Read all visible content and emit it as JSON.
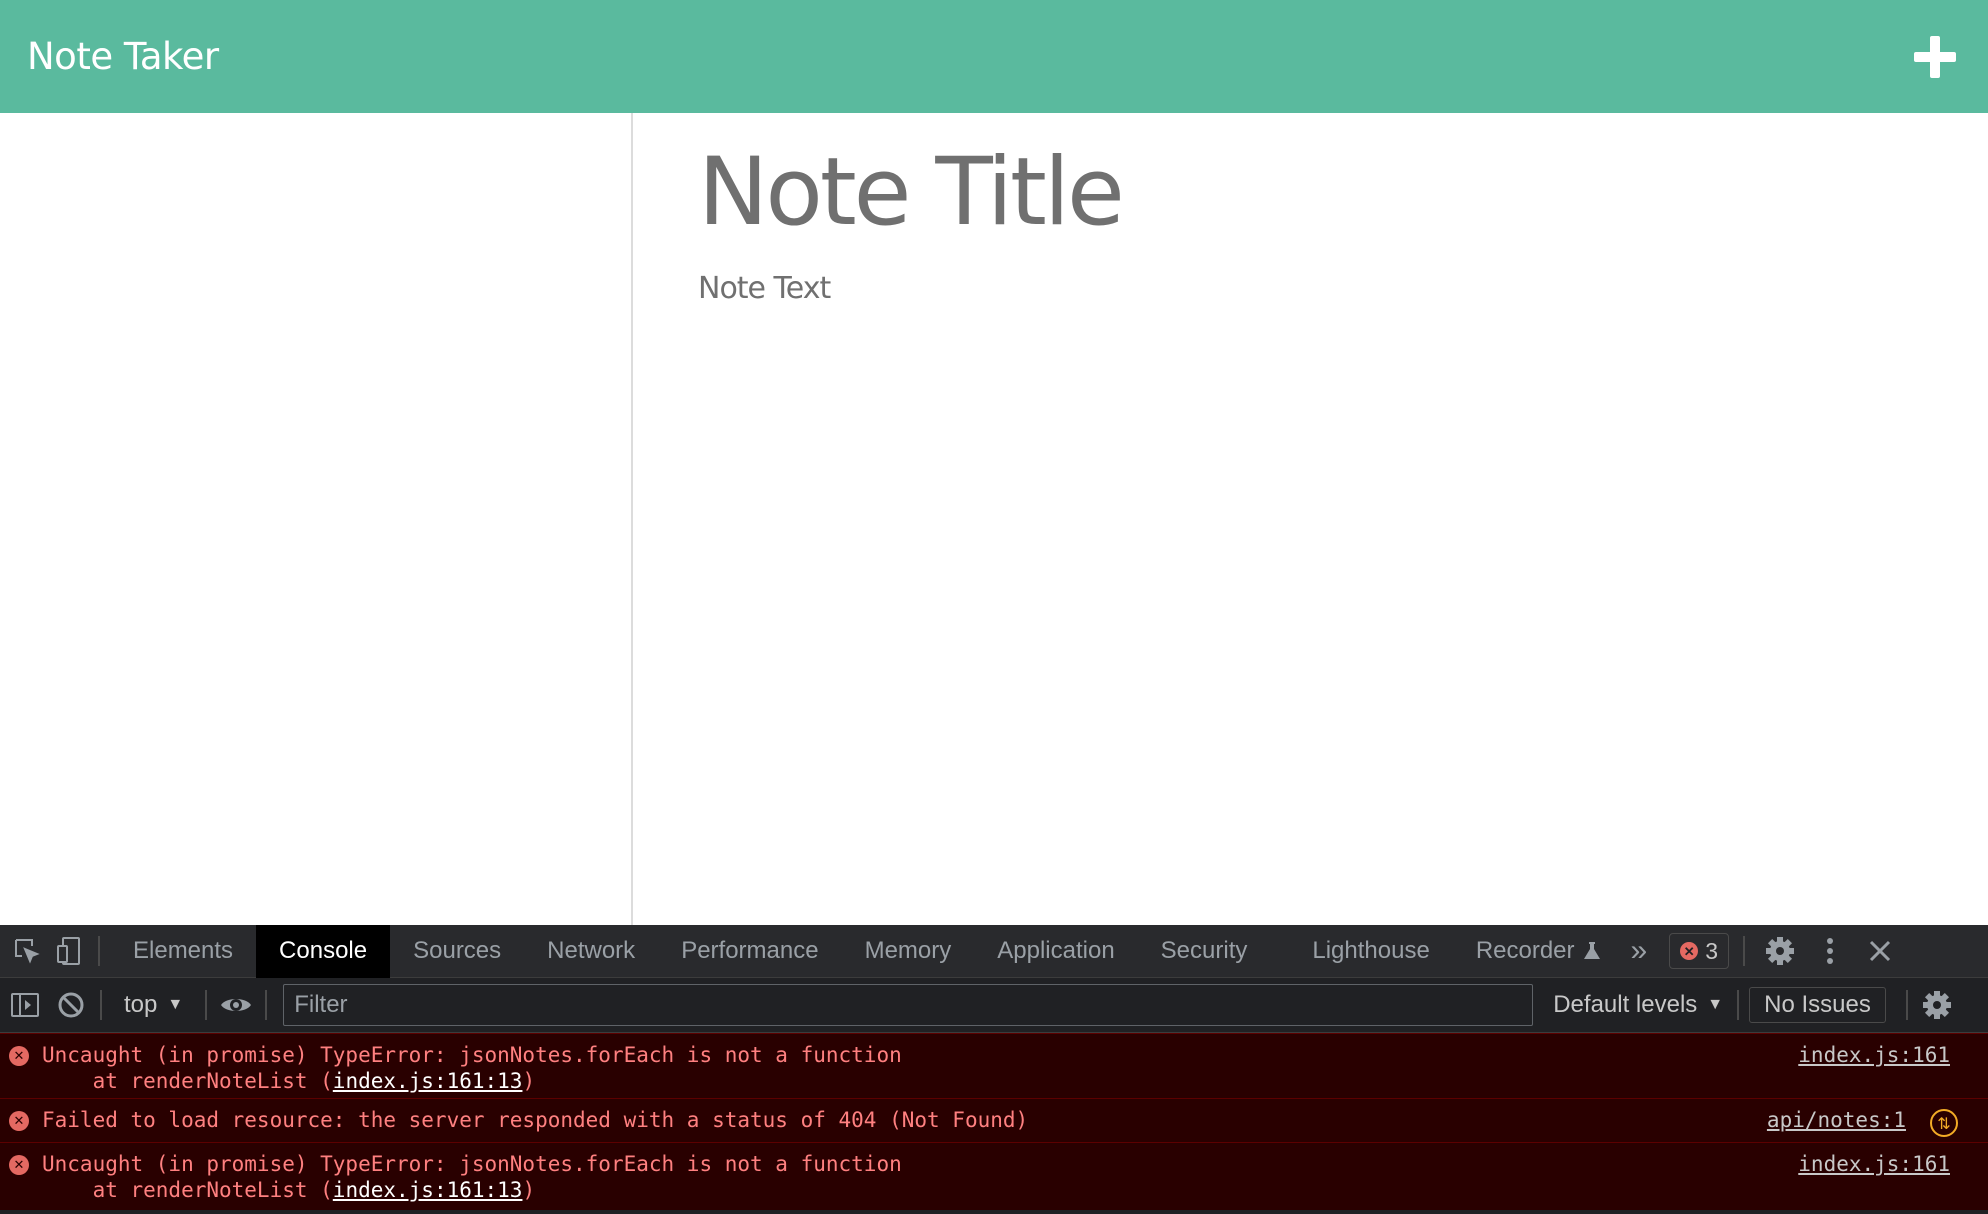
{
  "header": {
    "title": "Note Taker",
    "add_icon": "plus-icon"
  },
  "editor": {
    "title_placeholder": "Note Title",
    "text_placeholder": "Note Text"
  },
  "devtools": {
    "tabs": [
      "Elements",
      "Console",
      "Sources",
      "Network",
      "Performance",
      "Memory",
      "Application",
      "Security",
      "Lighthouse",
      "Recorder"
    ],
    "active_tab": "Console",
    "more_tabs": "»",
    "error_count": "3",
    "toolbar": {
      "context": "top",
      "filter_placeholder": "Filter",
      "levels": "Default levels",
      "issues": "No Issues"
    },
    "messages": [
      {
        "line1": "Uncaught (in promise) TypeError: jsonNotes.forEach is not a function",
        "line2_prefix": "    at renderNoteList (",
        "line2_link": "index.js:161:13",
        "line2_suffix": ")",
        "source": "index.js:161"
      },
      {
        "line1": "Failed to load resource: the server responded with a status of 404 (Not Found)",
        "source": "api/notes:1"
      },
      {
        "line1": "Uncaught (in promise) TypeError: jsonNotes.forEach is not a function",
        "line2_prefix": "    at renderNoteList (",
        "line2_link": "index.js:161:13",
        "line2_suffix": ")",
        "source": "index.js:161"
      }
    ],
    "colors": {
      "error_bg": "#290000",
      "error_text": "#ff8080"
    }
  },
  "colors": {
    "header_bg": "#5aba9e",
    "placeholder": "#707070"
  }
}
